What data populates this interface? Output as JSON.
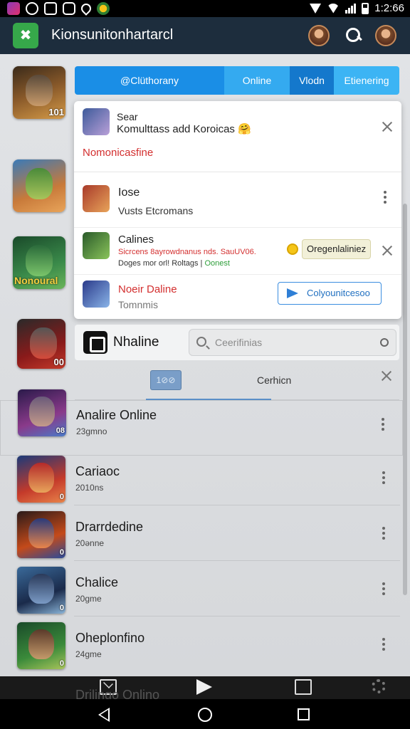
{
  "status_bar": {
    "time": "1:2:66",
    "icons": [
      "app-icon",
      "whatsapp-icon",
      "image-icon",
      "message-icon",
      "location-icon",
      "game-icon"
    ]
  },
  "app_bar": {
    "title": "Kionsunitonhartarcl",
    "logo_glyph": "✖",
    "accent": "#36a84a"
  },
  "tabs": [
    {
      "label": "@Clüthorany"
    },
    {
      "label": "Online"
    },
    {
      "label": "Vlodn"
    },
    {
      "label": "Etienering"
    }
  ],
  "notification": {
    "line1": "Sear",
    "line2": "Komulttass add Koroicas 🤗",
    "red_label": "Nomonicasfine",
    "rows": [
      {
        "title": "Iose",
        "sub": "Vusts Etcromans"
      },
      {
        "title": "Calines",
        "sub_red": "Sicrcens 8ayrowdnanus nds. SauUV06.",
        "sub2": "Doges mor orl! Roltags |",
        "sub2_green": "Oonest",
        "pill": "Oregenlaliniez"
      },
      {
        "title": "Noeir Daline",
        "sub": "Tomnmis",
        "button": "Colyounitcesoo"
      }
    ]
  },
  "search": {
    "brand_label": "Nhaline",
    "placeholder": "Ceerifinias"
  },
  "sort": {
    "chip": "1⊘⊘",
    "label": "Cerhicn"
  },
  "games": [
    {
      "name": "Analire Online",
      "size": "23gmno",
      "badge": "08"
    },
    {
      "name": "Cariaoc",
      "size": "2010ns",
      "badge": "0"
    },
    {
      "name": "Drarrdedine",
      "size": "20ənne",
      "badge": "0"
    },
    {
      "name": "Chalice",
      "size": "20gme",
      "badge": "0"
    },
    {
      "name": "Oheplonfino",
      "size": "24gme",
      "badge": "0"
    }
  ],
  "side_thumbs": [
    {
      "badge": "101"
    },
    {
      "badge": ""
    },
    {
      "badge": "Nonoural"
    },
    {
      "badge": "00"
    }
  ],
  "bottom_ghost_text": "Drilingo Onlino",
  "colors": {
    "appbar_bg": "#1d2d3d",
    "tab_primary": "#1a8ee6",
    "red_text": "#d32f2f",
    "link_blue": "#1f6fc0"
  }
}
